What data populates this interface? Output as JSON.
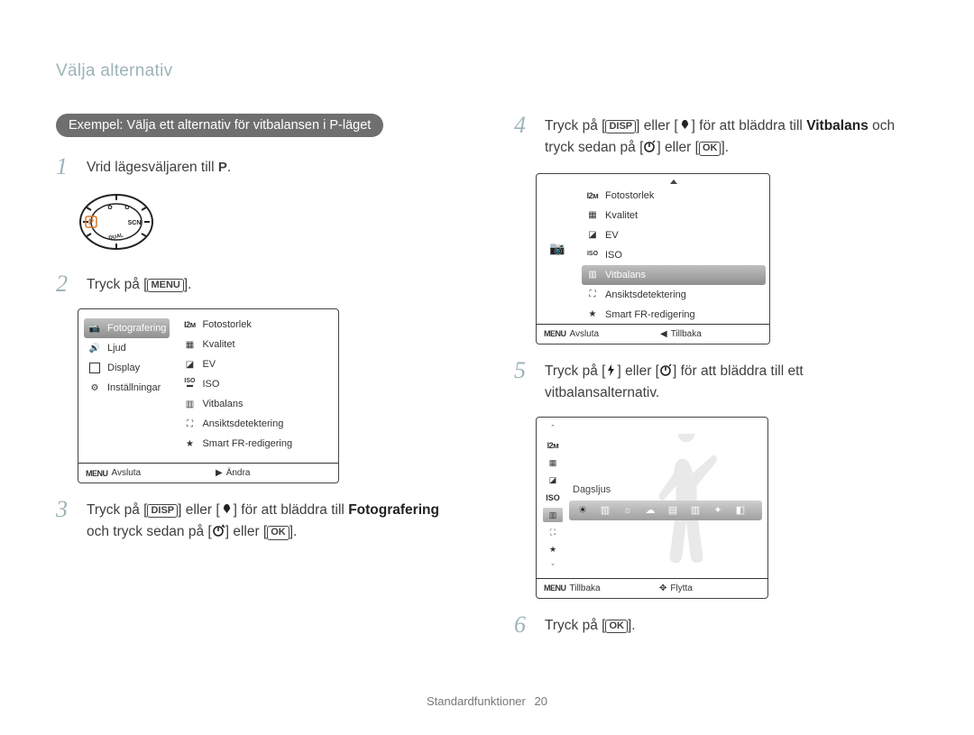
{
  "header": {
    "title": "Välja alternativ"
  },
  "example_label": "Exempel: Välja ett alternativ för vitbalansen i P-läget",
  "steps": {
    "s1": {
      "num": "1",
      "text_pre": "Vrid lägesväljaren till ",
      "text_post": "."
    },
    "s2": {
      "num": "2",
      "text_pre": "Tryck på [",
      "btn": "MENU",
      "text_post": "]."
    },
    "s3": {
      "num": "3",
      "part1": "Tryck på [",
      "btn": "DISP",
      "part2": "] eller [",
      "part3": "] för att bläddra till ",
      "bold": "Fotografering",
      "part4": " och tryck sedan på [",
      "part5": "] eller [",
      "btn2": "OK",
      "part6": "]."
    },
    "s4": {
      "num": "4",
      "part1": "Tryck på [",
      "btn": "DISP",
      "part2": "] eller [",
      "part3": "] för att bläddra till ",
      "bold": "Vitbalans",
      "part4": " och tryck sedan på [",
      "part5": "] eller [",
      "btn2": "OK",
      "part6": "]."
    },
    "s5": {
      "num": "5",
      "part1": "Tryck på [",
      "part2": "] eller [",
      "part3": "] för att bläddra till ett vitbalansalternativ."
    },
    "s6": {
      "num": "6",
      "text_pre": "Tryck på [",
      "btn": "OK",
      "text_post": "]."
    }
  },
  "lcd1": {
    "left": {
      "item1": "Fotografering",
      "item2": "Ljud",
      "item3": "Display",
      "item4": "Inställningar"
    },
    "right": {
      "i1": "Fotostorlek",
      "i2": "Kvalitet",
      "i3": "EV",
      "i4": "ISO",
      "i5": "Vitbalans",
      "i6": "Ansiktsdetektering",
      "i7": "Smart FR-redigering"
    },
    "footer": {
      "left": "Avsluta",
      "right": "Ändra"
    }
  },
  "lcd2": {
    "items": {
      "i1": "Fotostorlek",
      "i2": "Kvalitet",
      "i3": "EV",
      "i4": "ISO",
      "i5": "Vitbalans",
      "i6": "Ansiktsdetektering",
      "i7": "Smart FR-redigering"
    },
    "footer": {
      "left": "Avsluta",
      "right": "Tillbaka"
    }
  },
  "lcd3": {
    "label": "Dagsljus",
    "footer": {
      "left": "Tillbaka",
      "right": "Flytta"
    }
  },
  "footer": {
    "section": "Standardfunktioner",
    "page": "20"
  }
}
